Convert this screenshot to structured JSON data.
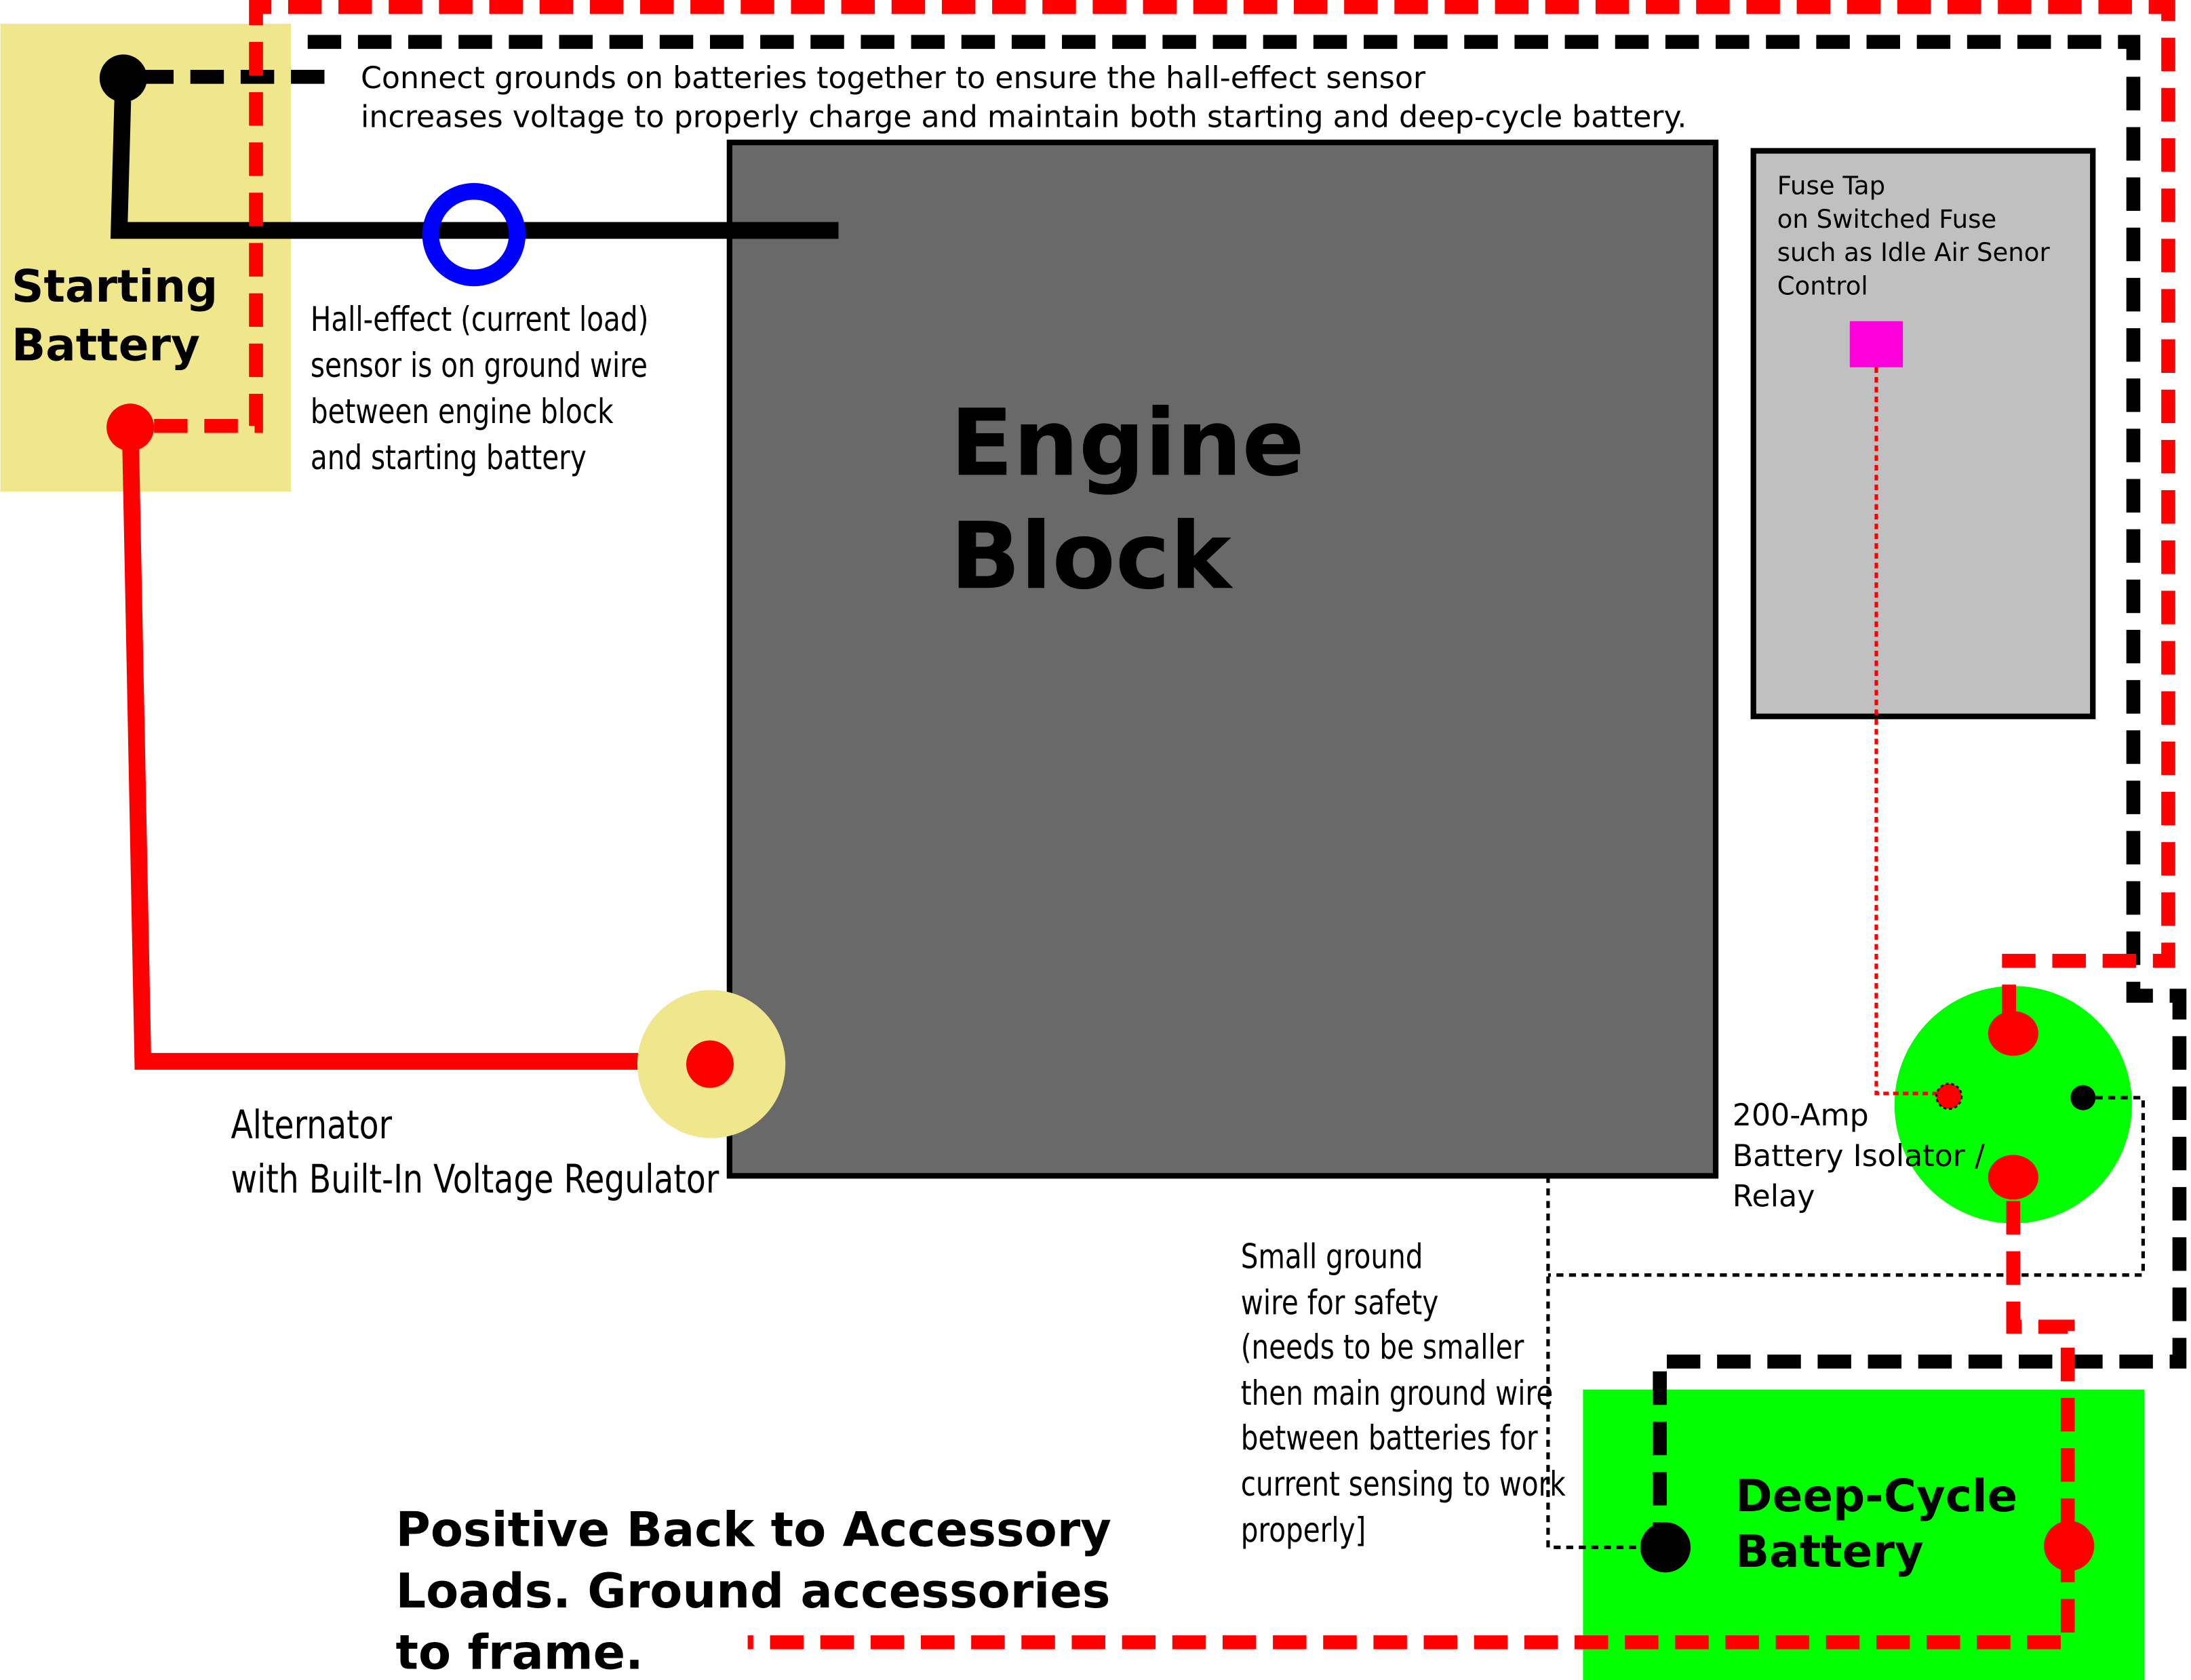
{
  "colors": {
    "positive_wire": "#ff0000",
    "ground_wire": "#000000",
    "hall_sensor": "#0000ff",
    "starting_battery": "#f0e68c",
    "alternator": "#f0e68c",
    "engine_block": "#696969",
    "fuse_box": "#c0c0c0",
    "fuse_tap": "#ff00dd",
    "isolator": "#00ff00",
    "deep_cycle_battery": "#00ff00"
  },
  "starting_battery": {
    "lines": [
      "Starting",
      "Battery"
    ]
  },
  "engine_block": {
    "lines": [
      "Engine",
      "Block"
    ]
  },
  "top_note": {
    "lines": [
      "Connect grounds on batteries together to ensure  the hall-effect sensor",
      "increases voltage to properly charge and maintain both starting and deep-cycle battery."
    ]
  },
  "hall_note": {
    "lines": [
      "Hall-effect (current load)",
      "sensor is on ground wire",
      "between engine block",
      "and starting battery"
    ]
  },
  "alternator": {
    "lines": [
      "Alternator",
      "with Built-In Voltage Regulator"
    ]
  },
  "fuse_box": {
    "lines": [
      "Fuse Tap",
      "on Switched Fuse",
      "such as Idle Air Senor",
      "Control"
    ]
  },
  "isolator": {
    "lines": [
      "200-Amp",
      "Battery Isolator /",
      "Relay"
    ]
  },
  "ground_note": {
    "lines": [
      "Small ground",
      "wire for safety",
      "(needs to be smaller",
      "then main ground wire",
      "between batteries for",
      "current sensing to work",
      "properly]"
    ]
  },
  "deep_cycle_battery": {
    "lines": [
      "Deep-Cycle",
      "Battery"
    ]
  },
  "accessory_note": {
    "lines": [
      "Positive Back to Accessory",
      "Loads. Ground accessories",
      "to frame."
    ]
  }
}
